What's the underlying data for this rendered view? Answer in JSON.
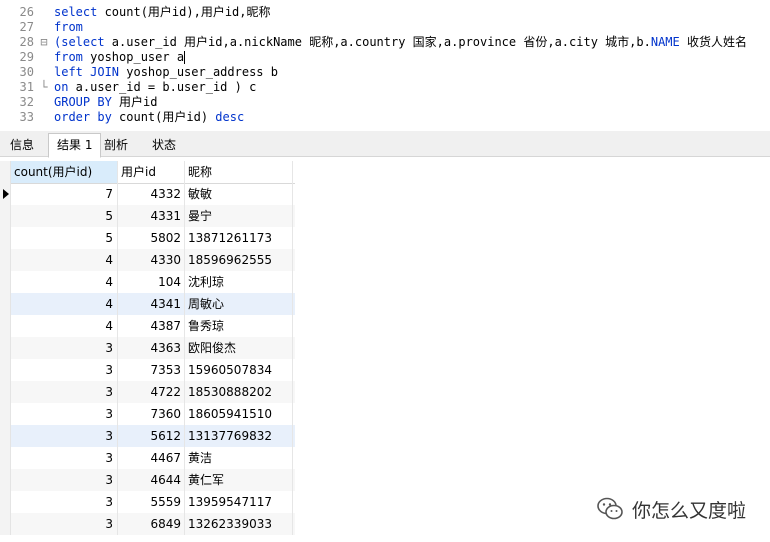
{
  "editor": {
    "lines": [
      {
        "num": "26",
        "fold": "",
        "html_parts": [
          {
            "t": "select",
            "k": 1
          },
          {
            "t": " count(用户id),用户id,昵称",
            "k": 0
          }
        ]
      },
      {
        "num": "27",
        "fold": "",
        "html_parts": [
          {
            "t": "from",
            "k": 1
          }
        ]
      },
      {
        "num": "28",
        "fold": "⊟",
        "html_parts": [
          {
            "t": "(select",
            "k": 1
          },
          {
            "t": " a.user_id 用户id,a.nickName 昵称,a.country 国家,a.province 省份,a.city 城市,b.",
            "k": 0
          },
          {
            "t": "NAME",
            "k": 1
          },
          {
            "t": " 收货人姓名",
            "k": 0
          }
        ]
      },
      {
        "num": "29",
        "fold": "",
        "html_parts": [
          {
            "t": "from",
            "k": 1
          },
          {
            "t": " yoshop_user a",
            "k": 0
          }
        ]
      },
      {
        "num": "30",
        "fold": "",
        "html_parts": [
          {
            "t": "left JOIN",
            "k": 1
          },
          {
            "t": " yoshop_user_address b",
            "k": 0
          }
        ]
      },
      {
        "num": "31",
        "fold": "└",
        "html_parts": [
          {
            "t": "on",
            "k": 1
          },
          {
            "t": " a.user_id = b.user_id ) c",
            "k": 0
          }
        ]
      },
      {
        "num": "32",
        "fold": "",
        "html_parts": [
          {
            "t": "GROUP BY",
            "k": 1
          },
          {
            "t": " 用户id",
            "k": 0
          }
        ]
      },
      {
        "num": "33",
        "fold": "",
        "html_parts": [
          {
            "t": "order by",
            "k": 1
          },
          {
            "t": " count(用户id) ",
            "k": 0
          },
          {
            "t": "desc",
            "k": 1
          }
        ]
      }
    ]
  },
  "tabs": [
    {
      "label": "信息"
    },
    {
      "label": "结果 1"
    },
    {
      "label": "剖析"
    },
    {
      "label": "状态"
    }
  ],
  "grid": {
    "headers": [
      "count(用户id)",
      "用户id",
      "昵称"
    ],
    "rows": [
      [
        "7",
        "4332",
        "敏敏"
      ],
      [
        "5",
        "4331",
        "曼宁"
      ],
      [
        "5",
        "5802",
        "13871261173"
      ],
      [
        "4",
        "4330",
        "18596962555"
      ],
      [
        "4",
        "104",
        "沈利琼"
      ],
      [
        "4",
        "4341",
        "周敏心"
      ],
      [
        "4",
        "4387",
        "鲁秀琼"
      ],
      [
        "3",
        "4363",
        "欧阳俊杰"
      ],
      [
        "3",
        "7353",
        "15960507834"
      ],
      [
        "3",
        "4722",
        "18530888202"
      ],
      [
        "3",
        "7360",
        "18605941510"
      ],
      [
        "3",
        "5612",
        "13137769832"
      ],
      [
        "3",
        "4467",
        "黄洁"
      ],
      [
        "3",
        "4644",
        "黄仁军"
      ],
      [
        "3",
        "5559",
        "13959547117"
      ],
      [
        "3",
        "6849",
        "13262339033"
      ]
    ]
  },
  "watermark": {
    "text": "你怎么又度啦",
    "icon": "wechat-icon"
  },
  "colors": {
    "keyword": "#0033cc",
    "header_selected": "#d9ecfb",
    "row_selected": "#e8f0fb"
  }
}
